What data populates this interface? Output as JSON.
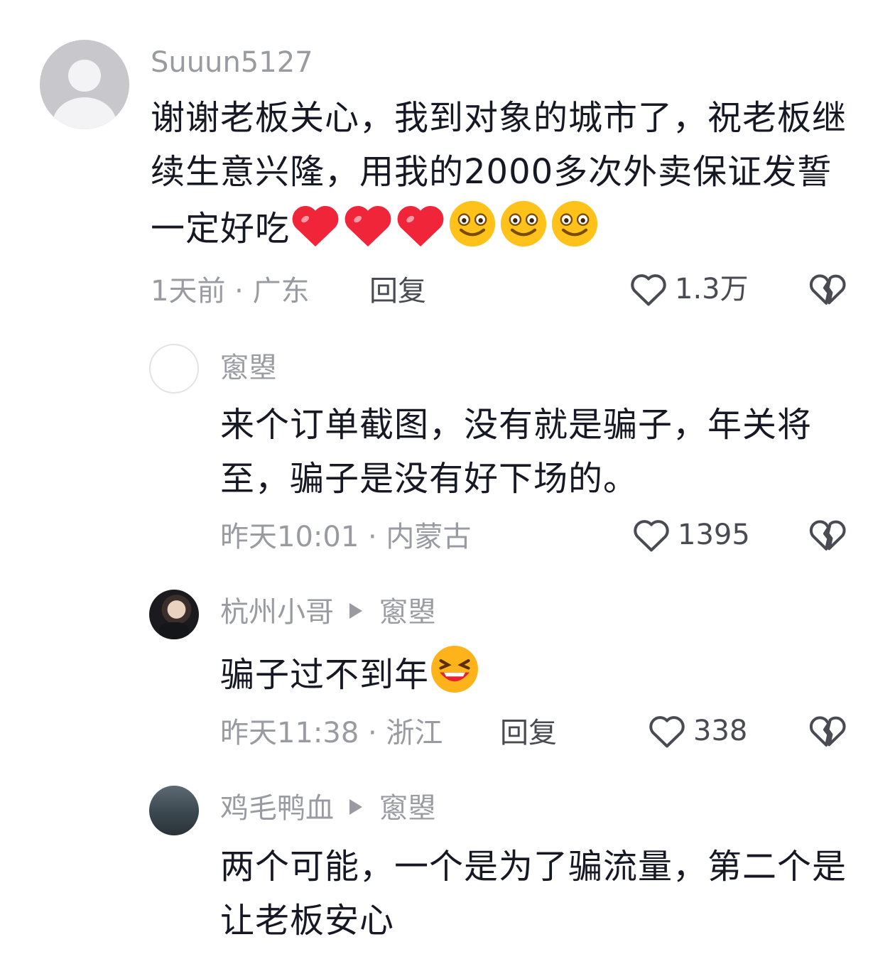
{
  "comments": [
    {
      "username": "Suuun5127",
      "content": "谢谢老板关心，我到对象的城市了，祝老板继续生意兴隆，用我的2000多次外卖保证发誓一定好吃",
      "time_location": "1天前 · 广东",
      "reply_label": "回复",
      "likes": "1.3万",
      "emojis": [
        "heart-emoji",
        "heart-emoji",
        "heart-emoji",
        "smile-emoji",
        "smile-emoji",
        "smile-emoji"
      ]
    },
    {
      "username": "窻曌",
      "content": "来个订单截图，没有就是骗子，年关将至，骗子是没有好下场的。",
      "time_location": "昨天10:01 · 内蒙古",
      "likes": "1395"
    },
    {
      "username": "杭州小哥",
      "reply_to": "窻曌",
      "content": "骗子过不到年",
      "time_location": "昨天11:38 · 浙江",
      "reply_label": "回复",
      "likes": "338",
      "emojis": [
        "laughing-emoji"
      ]
    },
    {
      "username": "鸡毛鸭血",
      "reply_to": "窻曌",
      "content": "两个可能，一个是为了骗流量，第二个是让老板安心"
    }
  ],
  "colors": {
    "text": "#161823",
    "muted": "#9a9ba1",
    "heart": "#f0253a",
    "emoji": "#ffc21a"
  }
}
